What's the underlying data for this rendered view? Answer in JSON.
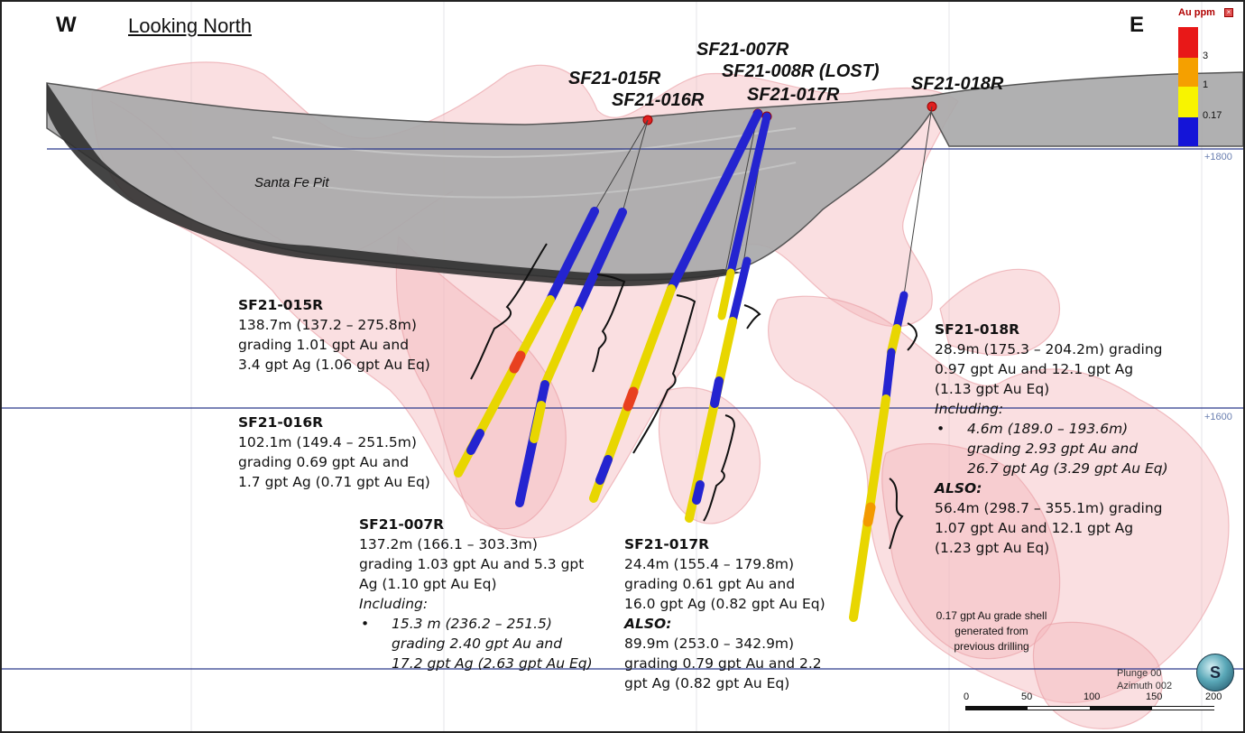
{
  "orientation": {
    "west": "W",
    "east": "E",
    "view": "Looking North"
  },
  "pit_label": "Santa Fe Pit",
  "elevations": [
    "+1800",
    "+1600"
  ],
  "holes": [
    "SF21-015R",
    "SF21-016R",
    "SF21-007R",
    "SF21-008R (LOST)",
    "SF21-017R",
    "SF21-018R"
  ],
  "legend": {
    "title": "Au ppm",
    "levels": [
      "3",
      "1",
      "0.17"
    ],
    "colors": {
      "high": "#e81818",
      "mid": "#f5a000",
      "low": "#f8f400",
      "base": "#1414d8"
    }
  },
  "results": {
    "r015": {
      "hole": "SF21-015R",
      "lines": [
        "138.7m (137.2 – 275.8m)",
        "grading 1.01 gpt Au and",
        "3.4 gpt Ag (1.06 gpt Au Eq)"
      ]
    },
    "r016": {
      "hole": "SF21-016R",
      "lines": [
        "102.1m (149.4 – 251.5m)",
        "grading 0.69 gpt Au and",
        "1.7 gpt Ag (0.71 gpt Au Eq)"
      ]
    },
    "r007": {
      "hole": "SF21-007R",
      "lines": [
        "137.2m (166.1 – 303.3m)",
        "grading 1.03 gpt Au and 5.3 gpt",
        "Ag (1.10 gpt Au Eq)"
      ],
      "including": "Including:",
      "sub": [
        "15.3 m (236.2 – 251.5)",
        "grading 2.40 gpt Au and",
        "17.2 gpt Ag (2.63 gpt Au Eq)"
      ]
    },
    "r017": {
      "hole": "SF21-017R",
      "lines": [
        "24.4m (155.4 – 179.8m)",
        "grading 0.61 gpt Au and",
        "16.0 gpt Ag (0.82 gpt Au Eq)"
      ],
      "also": "ALSO:",
      "lines2": [
        "89.9m (253.0 – 342.9m)",
        "grading 0.79 gpt Au and 2.2",
        "gpt Ag (0.82 gpt Au Eq)"
      ]
    },
    "r018": {
      "hole": "SF21-018R",
      "lines": [
        "28.9m (175.3 – 204.2m) grading",
        "0.97 gpt Au and 12.1 gpt Ag",
        "(1.13 gpt Au Eq)"
      ],
      "including": "Including:",
      "sub": [
        "4.6m (189.0 – 193.6m)",
        "grading 2.93 gpt Au and",
        "26.7 gpt Ag (3.29 gpt Au Eq)"
      ],
      "also": "ALSO:",
      "lines2": [
        "56.4m (298.7 – 355.1m) grading",
        "1.07 gpt Au and 12.1 gpt Ag",
        "(1.23 gpt Au Eq)"
      ]
    }
  },
  "grade_shell_note": [
    "0.17 gpt Au grade shell",
    "generated from",
    "previous drilling"
  ],
  "view_info": {
    "plunge": "Plunge 00",
    "azimuth": "Azimuth 002"
  },
  "compass_glyph": "S",
  "scale": {
    "ticks": [
      "0",
      "50",
      "100",
      "150",
      "200"
    ]
  }
}
